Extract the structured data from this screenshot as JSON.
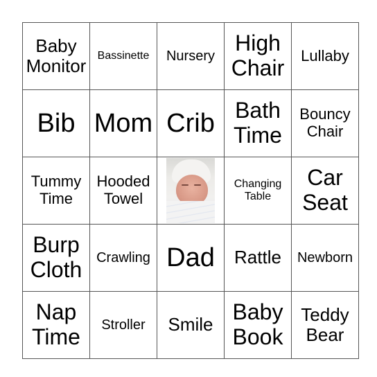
{
  "board": {
    "rows": [
      [
        {
          "text": "Baby Monitor",
          "size": "l"
        },
        {
          "text": "Bassinette",
          "size": "s"
        },
        {
          "text": "Nursery",
          "size": "m"
        },
        {
          "text": "High Chair",
          "size": "xl"
        },
        {
          "text": "Lullaby",
          "size": "ml"
        }
      ],
      [
        {
          "text": "Bib",
          "size": "xxl"
        },
        {
          "text": "Mom",
          "size": "xxl"
        },
        {
          "text": "Crib",
          "size": "xxl"
        },
        {
          "text": "Bath Time",
          "size": "xl"
        },
        {
          "text": "Bouncy Chair",
          "size": "ml"
        }
      ],
      [
        {
          "text": "Tummy Time",
          "size": "ml"
        },
        {
          "text": "Hooded Towel",
          "size": "ml"
        },
        {
          "text": "",
          "image": "newborn-baby-photo"
        },
        {
          "text": "Changing Table",
          "size": "s"
        },
        {
          "text": "Car Seat",
          "size": "xl"
        }
      ],
      [
        {
          "text": "Burp Cloth",
          "size": "xl"
        },
        {
          "text": "Crawling",
          "size": "m"
        },
        {
          "text": "Dad",
          "size": "xxl"
        },
        {
          "text": "Rattle",
          "size": "l"
        },
        {
          "text": "Newborn",
          "size": "m"
        }
      ],
      [
        {
          "text": "Nap Time",
          "size": "xl"
        },
        {
          "text": "Stroller",
          "size": "m"
        },
        {
          "text": "Smile",
          "size": "l"
        },
        {
          "text": "Baby Book",
          "size": "xl"
        },
        {
          "text": "Teddy Bear",
          "size": "l"
        }
      ]
    ]
  }
}
